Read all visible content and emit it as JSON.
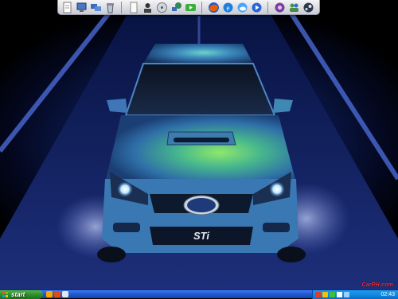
{
  "desktop": {
    "wallpaper": "Blue Subaru WRX STI driving on a night road"
  },
  "car": {
    "badge_text": "STi"
  },
  "dock": {
    "icons": [
      {
        "name": "document-icon",
        "color": "#e8e8e8"
      },
      {
        "name": "my-computer-icon",
        "color": "#4a78c8"
      },
      {
        "name": "network-icon",
        "color": "#3a6ab8"
      },
      {
        "name": "recycle-bin-icon",
        "color": "#8aa0b8"
      },
      {
        "name": "text-file-icon",
        "color": "#f0f0f0"
      },
      {
        "name": "user-folder-icon",
        "color": "#2a2a2a"
      },
      {
        "name": "disc-drive-icon",
        "color": "#9aa0a8"
      },
      {
        "name": "network-places-icon",
        "color": "#2e8b57"
      },
      {
        "name": "media-icon",
        "color": "#3cae3c"
      },
      {
        "name": "firefox-icon",
        "color": "#e66000"
      },
      {
        "name": "internet-explorer-icon",
        "color": "#1e7ee0"
      },
      {
        "name": "weather-icon",
        "color": "#4aa3ff"
      },
      {
        "name": "media-player-icon",
        "color": "#2a66d6"
      },
      {
        "name": "gallery-icon",
        "color": "#7b3fa0"
      },
      {
        "name": "messenger-icon",
        "color": "#3a9a3a"
      },
      {
        "name": "steam-icon",
        "color": "#2a3a4a"
      }
    ]
  },
  "taskbar": {
    "start_label": "start",
    "clock": "02:43"
  },
  "watermark": {
    "text": "CarPH.com"
  },
  "colors": {
    "taskbar_blue": "#245edb",
    "start_green": "#2f8f2c",
    "tray_blue": "#128ae0"
  }
}
